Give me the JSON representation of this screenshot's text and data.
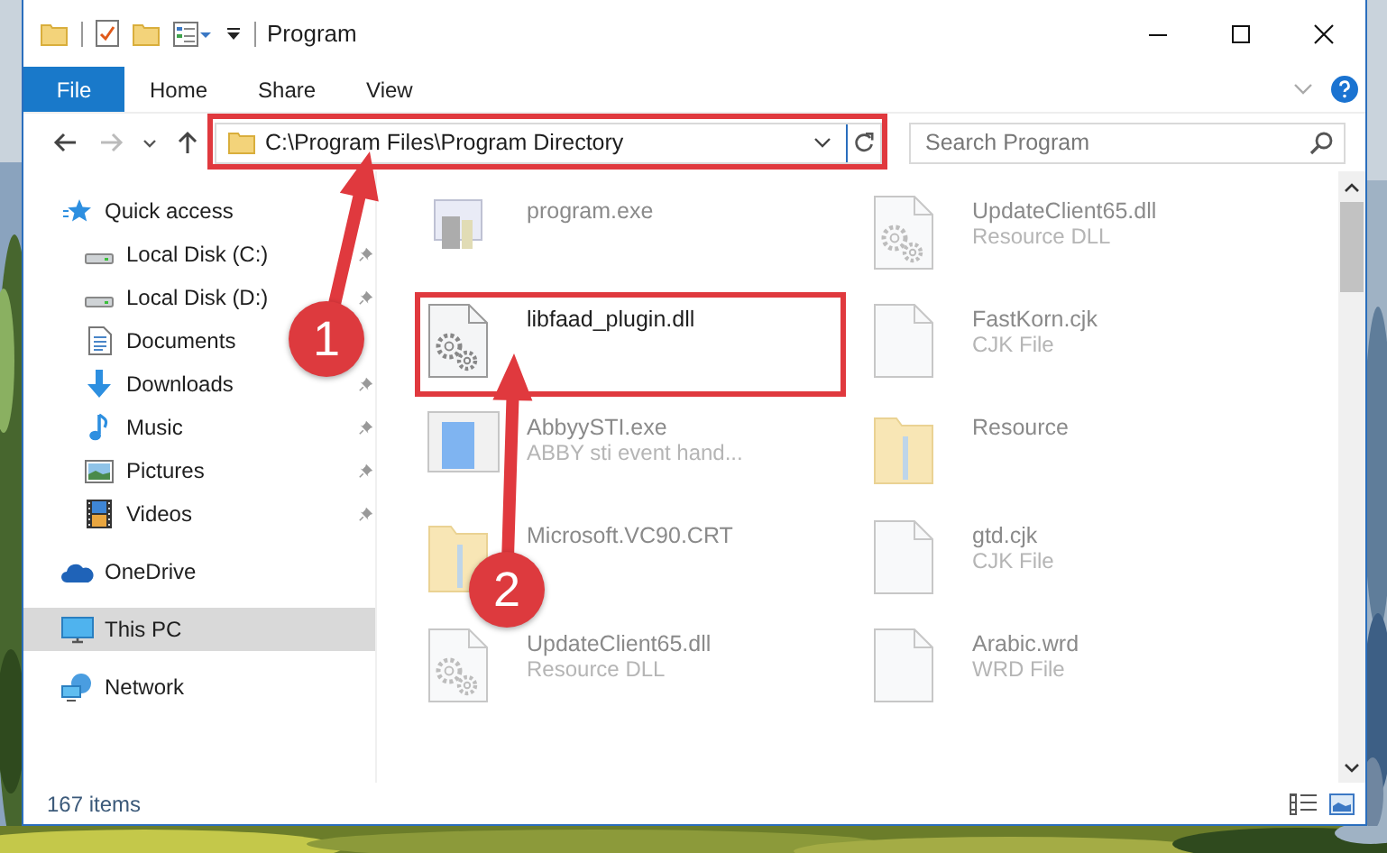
{
  "window": {
    "title": "Program"
  },
  "ribbon_tabs": [
    {
      "label": "File",
      "kind": "file"
    },
    {
      "label": "Home",
      "kind": "tab"
    },
    {
      "label": "Share",
      "kind": "tab"
    },
    {
      "label": "View",
      "kind": "tab"
    }
  ],
  "address_bar": {
    "path": "C:\\Program Files\\Program Directory"
  },
  "search": {
    "placeholder": "Search Program"
  },
  "sidebar": {
    "items": [
      {
        "label": "Quick access",
        "kind": "star",
        "selected": false,
        "children": [
          {
            "label": "Local Disk (C:)",
            "kind": "drive",
            "pinned": true,
            "selected": false
          },
          {
            "label": "Local Disk (D:)",
            "kind": "drive",
            "pinned": true,
            "selected": false
          },
          {
            "label": "Documents",
            "kind": "documents",
            "selected": false
          },
          {
            "label": "Downloads",
            "kind": "downloads",
            "pinned": true,
            "selected": false
          },
          {
            "label": "Music",
            "kind": "music",
            "pinned": true,
            "selected": false
          },
          {
            "label": "Pictures",
            "kind": "pictures",
            "pinned": true,
            "selected": false
          },
          {
            "label": "Videos",
            "kind": "videos",
            "pinned": true,
            "selected": false
          }
        ]
      },
      {
        "label": "OneDrive",
        "kind": "cloud",
        "selected": false
      },
      {
        "label": "This PC",
        "kind": "computer",
        "selected": true
      },
      {
        "label": "Network",
        "kind": "network",
        "selected": false
      }
    ]
  },
  "files": [
    {
      "name": "program.exe",
      "kind": "exe",
      "blurred": true
    },
    {
      "name": "UpdateClient65.dll",
      "type": "Resource DLL",
      "kind": "dll",
      "blurred": true
    },
    {
      "name": "libfaad_plugin.dll",
      "kind": "dll",
      "blurred": false
    },
    {
      "name": "FastKorn.cjk",
      "type": "CJK File",
      "kind": "file",
      "blurred": true
    },
    {
      "name": "AbbyySTI.exe",
      "type": "ABBY sti event hand...",
      "kind": "app",
      "blurred": true
    },
    {
      "name": "Resource",
      "kind": "folder",
      "blurred": true
    },
    {
      "name": "Microsoft.VC90.CRT",
      "kind": "folder",
      "blurred": true
    },
    {
      "name": "gtd.cjk",
      "type": "CJK File",
      "kind": "file",
      "blurred": true
    },
    {
      "name": "UpdateClient65.dll",
      "type": "Resource DLL",
      "kind": "dll",
      "blurred": true
    },
    {
      "name": "Arabic.wrd",
      "type": "WRD File",
      "kind": "file",
      "blurred": true
    }
  ],
  "status_bar": {
    "item_count": "167 items"
  },
  "annotations": [
    {
      "number": "1"
    },
    {
      "number": "2"
    }
  ]
}
